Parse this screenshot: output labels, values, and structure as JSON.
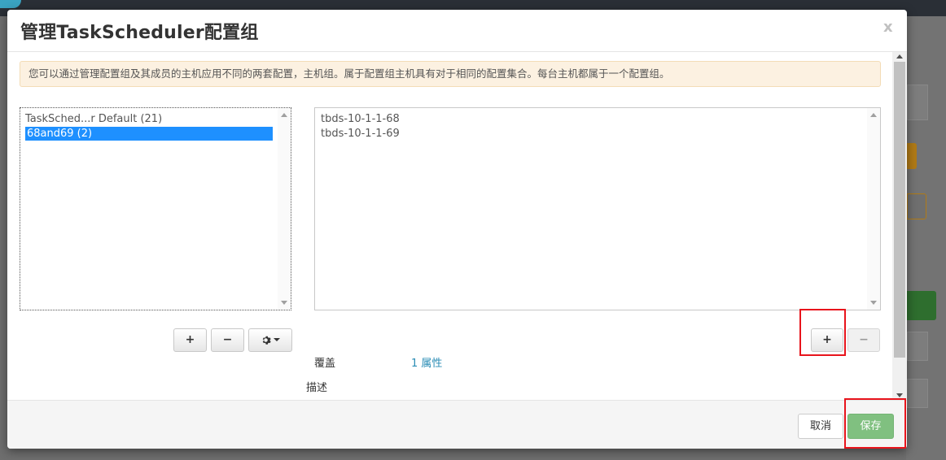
{
  "dialog": {
    "title": "管理TaskScheduler配置组",
    "close_label": "x",
    "info_message": "您可以通过管理配置组及其成员的主机应用不同的两套配置，主机组。属于配置组主机具有对于相同的配置集合。每台主机都属于一个配置组。"
  },
  "config_groups": {
    "items": [
      {
        "label": "TaskSched...r Default (21)",
        "selected": false
      },
      {
        "label": "68and69 (2)",
        "selected": true
      }
    ],
    "add_label": "+",
    "remove_label": "−",
    "settings_icon": "gear-icon"
  },
  "hosts": {
    "items": [
      "tbds-10-1-1-68",
      "tbds-10-1-1-69"
    ],
    "add_label": "+",
    "remove_label": "−"
  },
  "details": {
    "overrides_label": "覆盖",
    "overrides_value": "1 属性",
    "description_label": "描述"
  },
  "footer": {
    "cancel_label": "取消",
    "save_label": "保存"
  },
  "colors": {
    "selected_bg": "#1e90ff",
    "save_bg": "#80c080",
    "link": "#2a8cb5",
    "alert_bg": "#fcf1e1",
    "highlight": "#e8141c"
  }
}
